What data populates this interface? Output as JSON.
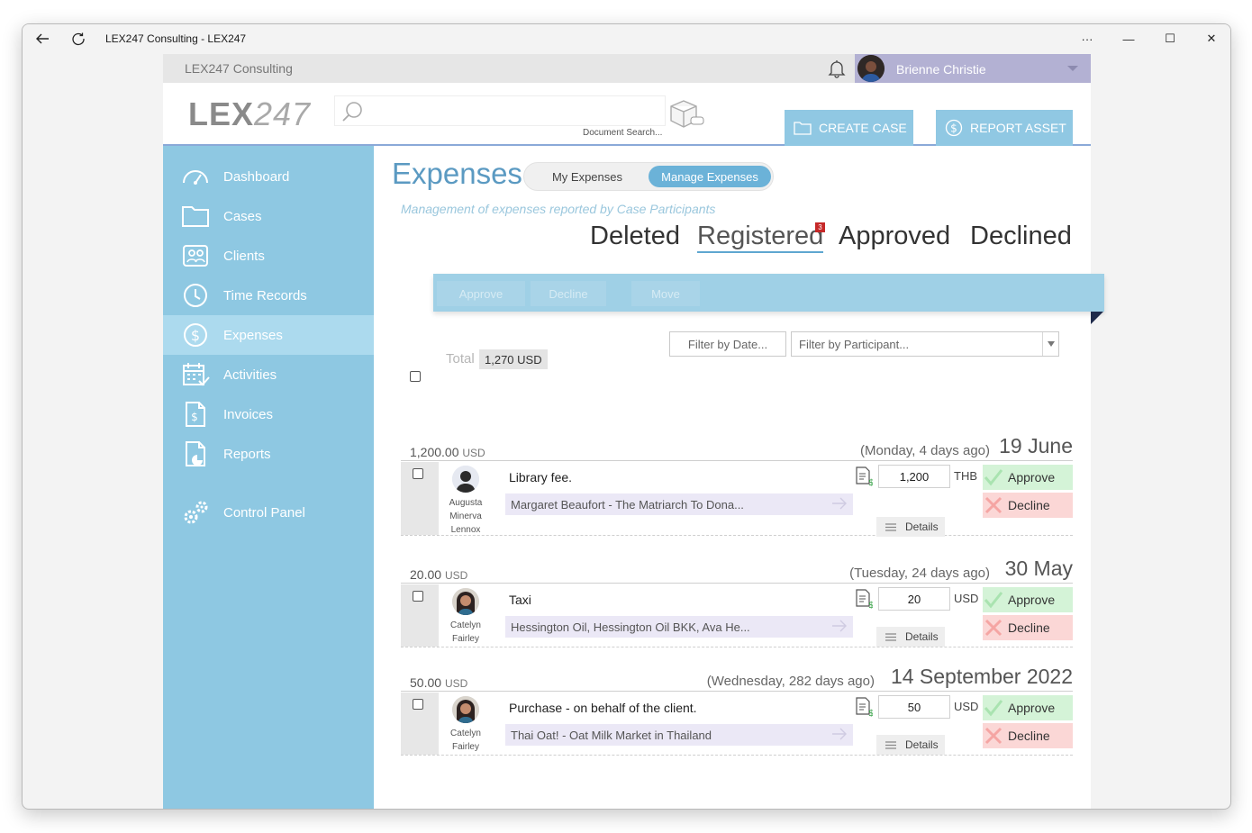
{
  "window": {
    "title": "LEX247 Consulting - LEX247",
    "more": "···",
    "minimize": "—",
    "maximize": "☐",
    "close": "✕"
  },
  "topbar": {
    "company": "LEX247 Consulting",
    "user_name": "Brienne Christie"
  },
  "header": {
    "logo_bold": "LEX",
    "logo_thin": "247",
    "search_placeholder": "",
    "search_hint": "Document Search...",
    "create_case": "CREATE CASE",
    "report_asset": "REPORT ASSET"
  },
  "sidebar": {
    "items": [
      {
        "label": "Dashboard",
        "icon": "gauge-icon"
      },
      {
        "label": "Cases",
        "icon": "folder-icon"
      },
      {
        "label": "Clients",
        "icon": "clients-icon"
      },
      {
        "label": "Time Records",
        "icon": "clock-icon"
      },
      {
        "label": "Expenses",
        "icon": "dollar-icon",
        "active": true
      },
      {
        "label": "Activities",
        "icon": "calendar-icon"
      },
      {
        "label": "Invoices",
        "icon": "invoice-icon"
      },
      {
        "label": "Reports",
        "icon": "reports-icon"
      },
      {
        "label": "Control Panel",
        "icon": "gears-icon"
      }
    ]
  },
  "main": {
    "title": "Expenses",
    "toggle": {
      "my": "My Expenses",
      "manage": "Manage Expenses"
    },
    "subtitle": "Management of expenses reported by Case Participants",
    "tabs": {
      "deleted": "Deleted",
      "registered": "Registered",
      "registered_badge": "3",
      "approved": "Approved",
      "declined": "Declined"
    },
    "actions": {
      "approve": "Approve",
      "decline": "Decline",
      "move": "Move"
    },
    "filters": {
      "date": "Filter by Date...",
      "participant": "Filter by Participant..."
    },
    "total_label": "Total",
    "total_value": "1,270 USD",
    "details_label": "Details",
    "approve_label": "Approve",
    "decline_label": "Decline"
  },
  "expenses": [
    {
      "amount": "1,200.00",
      "amount_cur": "USD",
      "relative": "(Monday, 4 days ago)",
      "date": "19 June",
      "person_lines": [
        "Augusta",
        "Minerva",
        "Lennox"
      ],
      "description": "Library fee.",
      "project": "Margaret Beaufort - The Matriarch To Dona...",
      "value": "1,200",
      "currency": "THB"
    },
    {
      "amount": "20.00",
      "amount_cur": "USD",
      "relative": "(Tuesday, 24 days ago)",
      "date": "30 May",
      "person_lines": [
        "Catelyn",
        "Fairley"
      ],
      "description": "Taxi",
      "project": "Hessington Oil, Hessington Oil BKK, Ava He...",
      "value": "20",
      "currency": "USD"
    },
    {
      "amount": "50.00",
      "amount_cur": "USD",
      "relative": "(Wednesday, 282 days ago)",
      "date": "14 September 2022",
      "person_lines": [
        "Catelyn",
        "Fairley"
      ],
      "description": "Purchase - on behalf of the client.",
      "project": "Thai Oat! - Oat Milk Market in Thailand",
      "value": "50",
      "currency": "USD"
    }
  ]
}
